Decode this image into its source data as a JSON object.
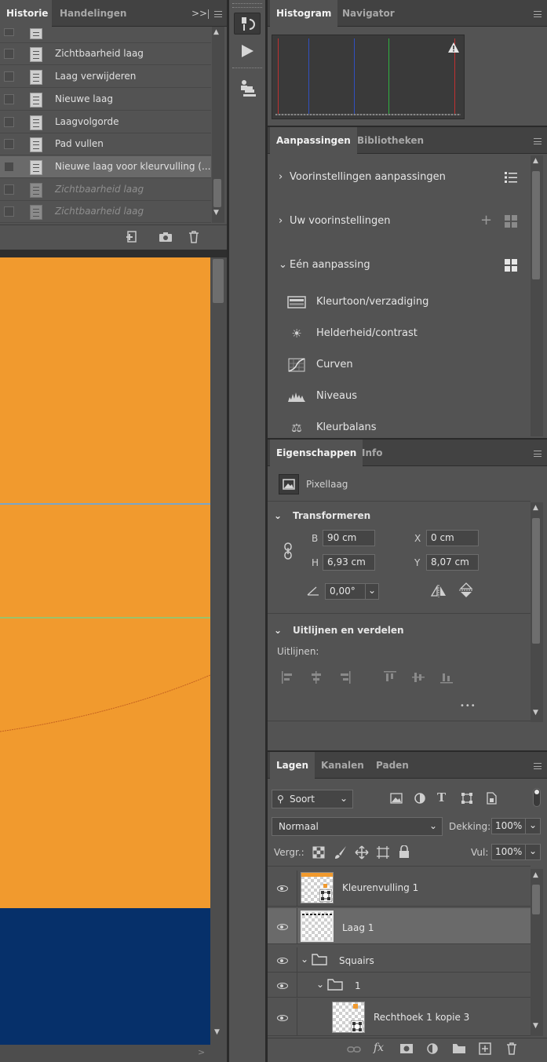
{
  "history_panel": {
    "tabs": [
      "Historie",
      "Handelingen"
    ],
    "items": [
      {
        "label": "Zichtbaarheid laag",
        "state": "normal"
      },
      {
        "label": "Laag verwijderen",
        "state": "normal"
      },
      {
        "label": "Nieuwe laag",
        "state": "normal"
      },
      {
        "label": "Laagvolgorde",
        "state": "normal"
      },
      {
        "label": "Pad vullen",
        "state": "normal"
      },
      {
        "label": "Nieuwe laag voor kleurvulling (...",
        "state": "selected"
      },
      {
        "label": "Zichtbaarheid laag",
        "state": "dimmed"
      },
      {
        "label": "Zichtbaarheid laag",
        "state": "dimmed"
      }
    ],
    "footer_icons": [
      "new-document-from-state-icon",
      "camera-icon",
      "trash-icon"
    ]
  },
  "canvas": {
    "colors": {
      "orange": "#f19a2e",
      "navy": "#06306a",
      "guide_blue": "#7aa6c8",
      "guide_green": "#9bc26a"
    }
  },
  "toolstrip": {
    "icons": [
      "history-brush-icon",
      "play-icon",
      "stamp-icon"
    ]
  },
  "histogram_panel": {
    "tabs": [
      "Histogram",
      "Navigator"
    ],
    "warning_icon": "warning-icon"
  },
  "adjustments_panel": {
    "tabs": [
      "Aanpassingen",
      "Bibliotheken"
    ],
    "sections": [
      {
        "label": "Voorinstellingen aanpassingen",
        "expanded": false
      },
      {
        "label": "Uw voorinstellingen",
        "expanded": false
      },
      {
        "label": "Eén aanpassing",
        "expanded": true
      }
    ],
    "items": [
      {
        "label": "Kleurtoon/verzadiging",
        "icon": "hue-saturation-icon"
      },
      {
        "label": "Helderheid/contrast",
        "icon": "brightness-contrast-icon"
      },
      {
        "label": "Curven",
        "icon": "curves-icon"
      },
      {
        "label": "Niveaus",
        "icon": "levels-icon"
      },
      {
        "label": "Kleurbalans",
        "icon": "color-balance-icon"
      }
    ]
  },
  "properties_panel": {
    "tabs": [
      "Eigenschappen",
      "Info"
    ],
    "layer_type": "Pixellaag",
    "transform": {
      "title": "Transformeren",
      "b_label": "B",
      "b_value": "90 cm",
      "h_label": "H",
      "h_value": "6,93 cm",
      "x_label": "X",
      "x_value": "0 cm",
      "y_label": "Y",
      "y_value": "8,07 cm",
      "angle_value": "0,00°"
    },
    "align": {
      "title": "Uitlijnen en verdelen",
      "label": "Uitlijnen:",
      "more": "•••"
    }
  },
  "layers_panel": {
    "tabs": [
      "Lagen",
      "Kanalen",
      "Paden"
    ],
    "filter_kind": "Soort",
    "blend_mode": "Normaal",
    "opacity_label": "Dekking:",
    "opacity_value": "100%",
    "lock_label": "Vergr.:",
    "fill_label": "Vul:",
    "fill_value": "100%",
    "layers": [
      {
        "name": "Kleurenvulling 1",
        "kind": "fill",
        "selected": false
      },
      {
        "name": "Laag 1",
        "kind": "pixel",
        "selected": true
      },
      {
        "name": "Squairs",
        "kind": "group",
        "selected": false
      },
      {
        "name": "1",
        "kind": "group",
        "selected": false
      },
      {
        "name": "Rechthoek 1 kopie 3",
        "kind": "shape",
        "selected": false
      }
    ],
    "footer_icons": [
      "link-icon",
      "fx-icon",
      "mask-icon",
      "adjustment-icon",
      "folder-icon",
      "new-layer-icon",
      "trash-icon"
    ],
    "fx_label": "fx"
  }
}
